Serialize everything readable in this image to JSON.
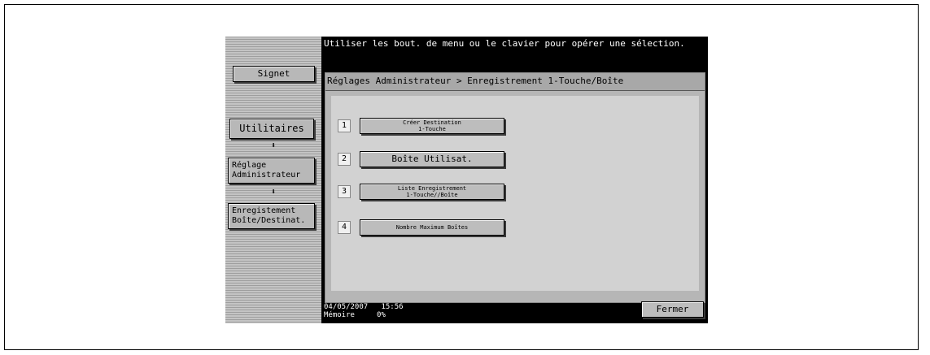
{
  "sidebar": {
    "signet": "Signet",
    "utilitaires": "Utilitaires",
    "reglage": "Réglage\nAdministrateur",
    "enregistrement": "Enregistement\nBoîte/Destinat.",
    "arrow": "⬇"
  },
  "header": {
    "instruction": "Utiliser les bout. de menu ou le clavier pour opérer une sélection.",
    "breadcrumb": "Réglages Administrateur > Enregistrement 1-Touche/Boîte"
  },
  "menu": [
    {
      "num": "1",
      "label": "Créer Destination\n1-Touche"
    },
    {
      "num": "2",
      "label": "Boîte Utilisat."
    },
    {
      "num": "3",
      "label": "Liste Enregistrement\n1-Touche//Boîte"
    },
    {
      "num": "4",
      "label": "Nombre Maximum Boîtes"
    }
  ],
  "status": {
    "date": "04/05/2007",
    "time": "15:56",
    "memory_label": "Mémoire",
    "memory_value": "0%"
  },
  "footer": {
    "close": "Fermer"
  }
}
